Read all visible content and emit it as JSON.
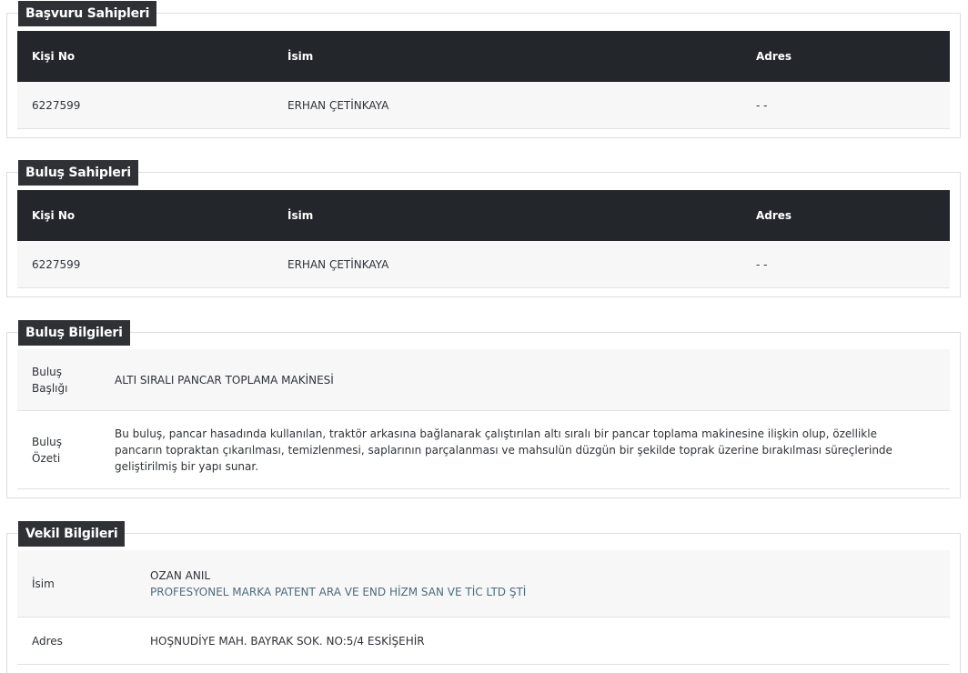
{
  "basvuru": {
    "title": "Başvuru Sahipleri",
    "headers": [
      "Kişi No",
      "İsim",
      "Adres"
    ],
    "rows": [
      [
        "6227599",
        "ERHAN ÇETİNKAYA",
        "- -"
      ]
    ]
  },
  "bulus_sahipleri": {
    "title": "Buluş Sahipleri",
    "headers": [
      "Kişi No",
      "İsim",
      "Adres"
    ],
    "rows": [
      [
        "6227599",
        "ERHAN ÇETİNKAYA",
        "- -"
      ]
    ]
  },
  "bulus_bilgileri": {
    "title": "Buluş Bilgileri",
    "baslik_label_1": "Buluş",
    "baslik_label_2": "Başlığı",
    "baslik_value": "ALTI SIRALI PANCAR TOPLAMA MAKİNESİ",
    "ozet_label_1": "Buluş",
    "ozet_label_2": "Özeti",
    "ozet_value": "Bu buluş, pancar hasadında kullanılan, traktör arkasına bağlanarak çalıştırılan altı sıralı bir pancar toplama makinesine ilişkin olup, özellikle pancarın topraktan çıkarılması, temizlenmesi, saplarının parçalanması ve mahsulün düzgün bir şekilde toprak üzerine bırakılması süreçlerinde geliştirilmiş bir yapı sunar."
  },
  "vekil": {
    "title": "Vekil Bilgileri",
    "isim_label": "İsim",
    "isim_value": "OZAN ANIL",
    "firma": "PROFESYONEL MARKA PATENT ARA VE END HİZM SAN VE TİC LTD ŞTİ",
    "adres_label": "Adres",
    "adres_value": "HOŞNUDİYE MAH. BAYRAK SOK. NO:5/4 ESKİŞEHİR"
  }
}
